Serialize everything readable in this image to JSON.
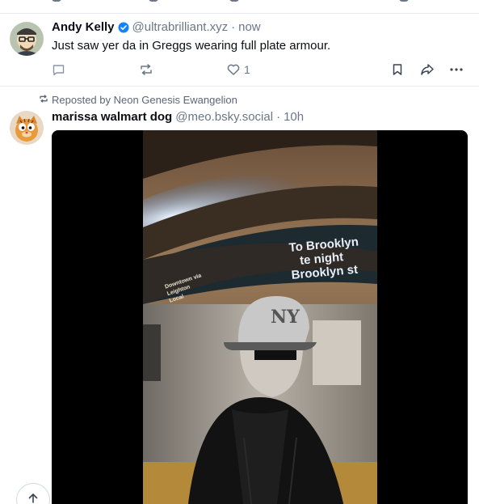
{
  "post1": {
    "author_name": "Andy Kelly",
    "handle": "@ultrabrilliant.xyz",
    "time": "now",
    "text": "Just saw yer da in Greggs wearing full plate armour.",
    "like_count": "1",
    "icons": [
      "reply-icon",
      "repost-icon",
      "like-icon",
      "bookmark-icon",
      "share-icon",
      "more-icon"
    ]
  },
  "post2": {
    "repost_label": "Reposted by Neon Genesis Ewangelion",
    "author_name": "marissa walmart dog",
    "handle": "@meo.bsky.social",
    "time": "10h",
    "video": {
      "sign_line1": "To Brooklyn",
      "sign_line2": "te night",
      "sign_line3": "Brooklyn st",
      "train_line1": "Downtown via",
      "train_line2": "Leighton",
      "train_line3": "Local"
    }
  },
  "colors": {
    "accent": "#1083fe",
    "muted": "#6b7787",
    "divider": "#e6e9ee"
  }
}
